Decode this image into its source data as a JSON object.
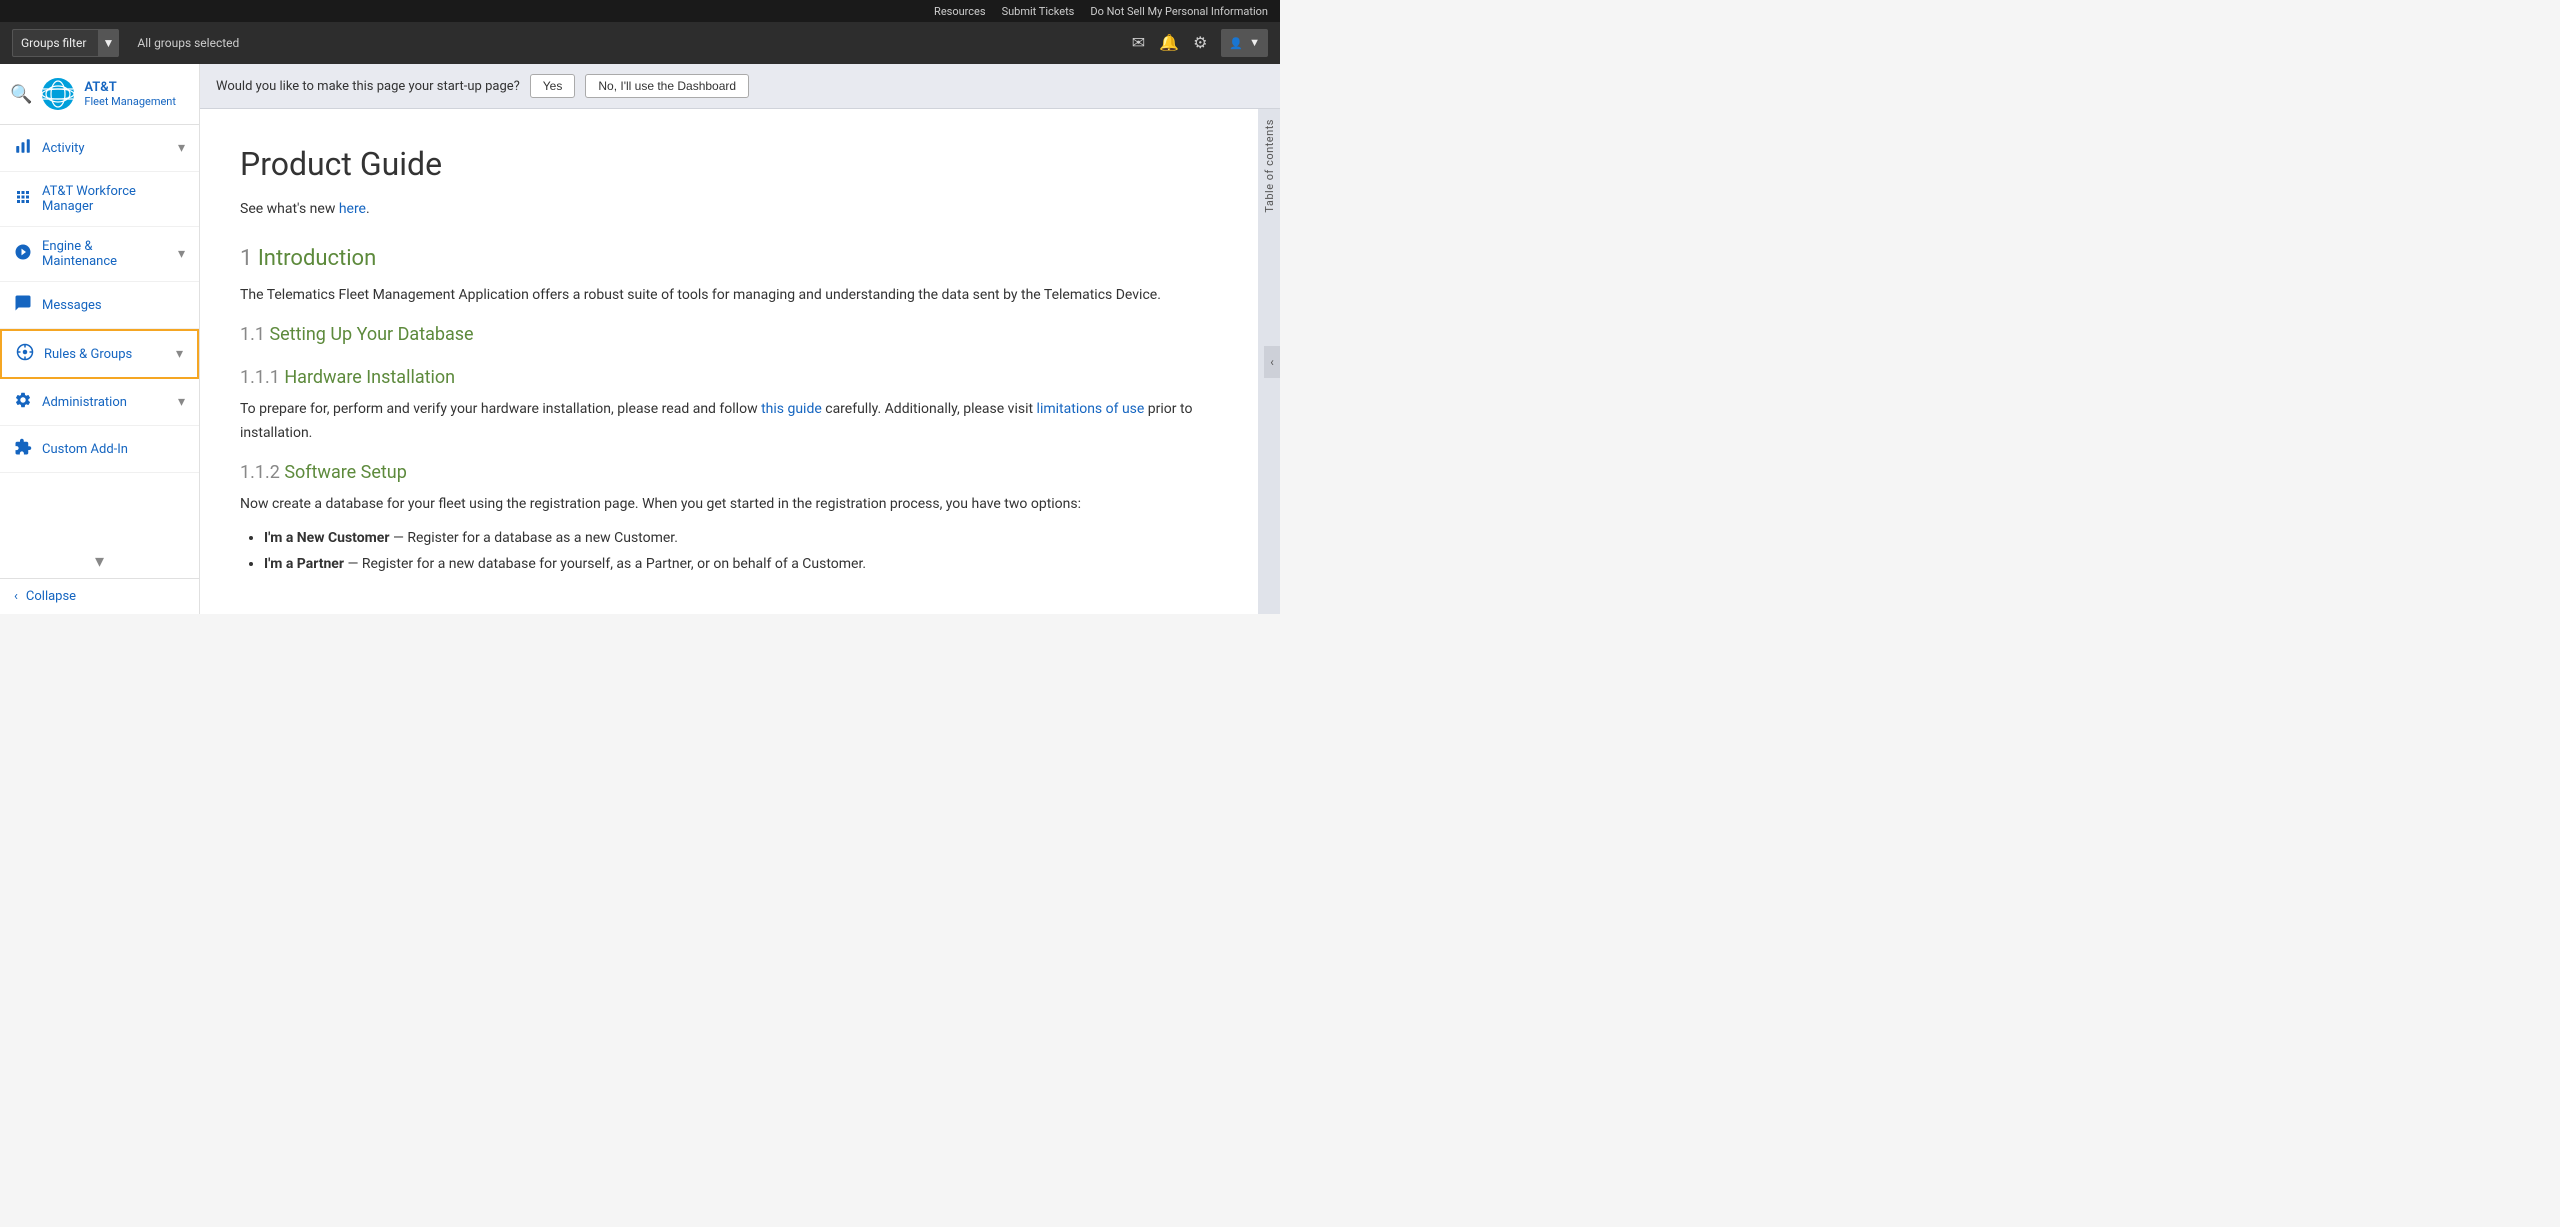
{
  "topnav": {
    "links": [
      "Resources",
      "Submit Tickets",
      "Do Not Sell My Personal Information"
    ]
  },
  "secondbar": {
    "groups_filter_label": "Groups filter",
    "all_groups_label": "All groups selected",
    "icons": [
      "email",
      "bell",
      "gear",
      "person"
    ],
    "user_label": ""
  },
  "sidebar": {
    "company": {
      "name": "AT&T",
      "sub": "Fleet Management"
    },
    "items": [
      {
        "label": "Activity",
        "icon": "📊",
        "has_chevron": true
      },
      {
        "label": "AT&T Workforce Manager",
        "icon": "🧩",
        "has_chevron": false
      },
      {
        "label": "Engine & Maintenance",
        "icon": "🎥",
        "has_chevron": true
      },
      {
        "label": "Messages",
        "icon": "✉️",
        "has_chevron": false
      },
      {
        "label": "Rules & Groups",
        "icon": "🔵",
        "has_chevron": true,
        "active": true
      },
      {
        "label": "Administration",
        "icon": "⚙️",
        "has_chevron": true
      },
      {
        "label": "Custom Add-In",
        "icon": "🧩",
        "has_chevron": false
      }
    ],
    "collapse_label": "Collapse"
  },
  "startup_bar": {
    "question": "Would you like to make this page your start-up page?",
    "yes_label": "Yes",
    "no_label": "No, I'll use the Dashboard"
  },
  "doc": {
    "title": "Product Guide",
    "subtitle_text": "See what's new ",
    "subtitle_link_text": "here",
    "subtitle_link_url": "#",
    "sections": [
      {
        "num": "1",
        "title": "Introduction",
        "body": "The Telematics Fleet Management Application offers a robust suite of tools for managing and understanding the data sent by the Telematics Device.",
        "subsections": [
          {
            "num": "1.1",
            "title": "Setting Up Your Database",
            "subsubs": [
              {
                "num": "1.1.1",
                "title": "Hardware Installation",
                "body": "To prepare for, perform and verify your hardware installation, please read and follow ",
                "link1_text": "this guide",
                "link1_url": "#",
                "body2": " carefully. Additionally, please visit ",
                "link2_text": "limitations of use",
                "link2_url": "#",
                "body3": " prior to installation."
              },
              {
                "num": "1.1.2",
                "title": "Software Setup",
                "body": "Now create a database for your fleet using the registration page. When you get started in the registration process, you have two options:",
                "list_items": [
                  {
                    "bold": "I'm a New Customer",
                    "text": " — Register for a database as a new Customer."
                  },
                  {
                    "bold": "I'm a Partner",
                    "text": " — Register for a new database for yourself, as a Partner, or on behalf of a Customer."
                  }
                ]
              }
            ]
          }
        ]
      }
    ],
    "toc_label": "Table of contents"
  }
}
